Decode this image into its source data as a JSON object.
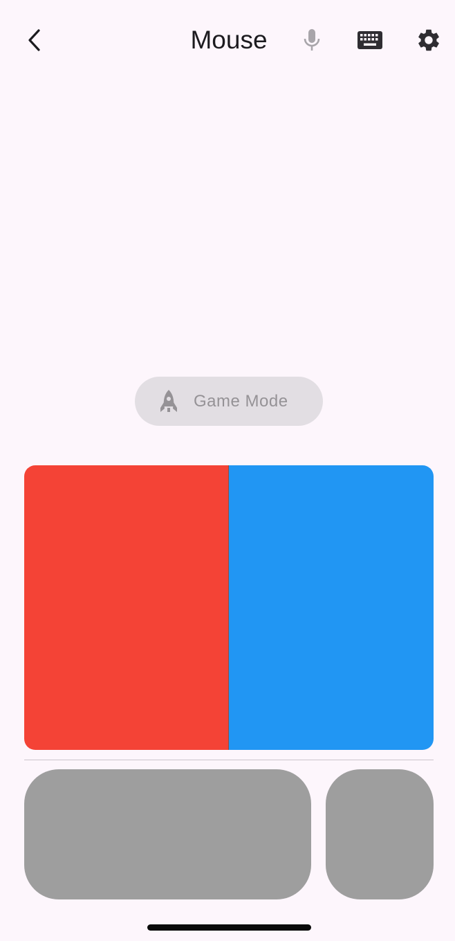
{
  "header": {
    "title": "Mouse",
    "back_icon": "chevron-left-icon",
    "mic_icon": "microphone-icon",
    "keyboard_icon": "keyboard-icon",
    "settings_icon": "gear-icon"
  },
  "game_mode": {
    "label": "Game Mode",
    "icon": "rocket-icon"
  },
  "colors": {
    "background": "#fdf6fc",
    "left_click": "#f44336",
    "right_click": "#2196f3",
    "pad_buttons": "#9e9e9e",
    "game_mode_pill": "#e2dee3"
  }
}
